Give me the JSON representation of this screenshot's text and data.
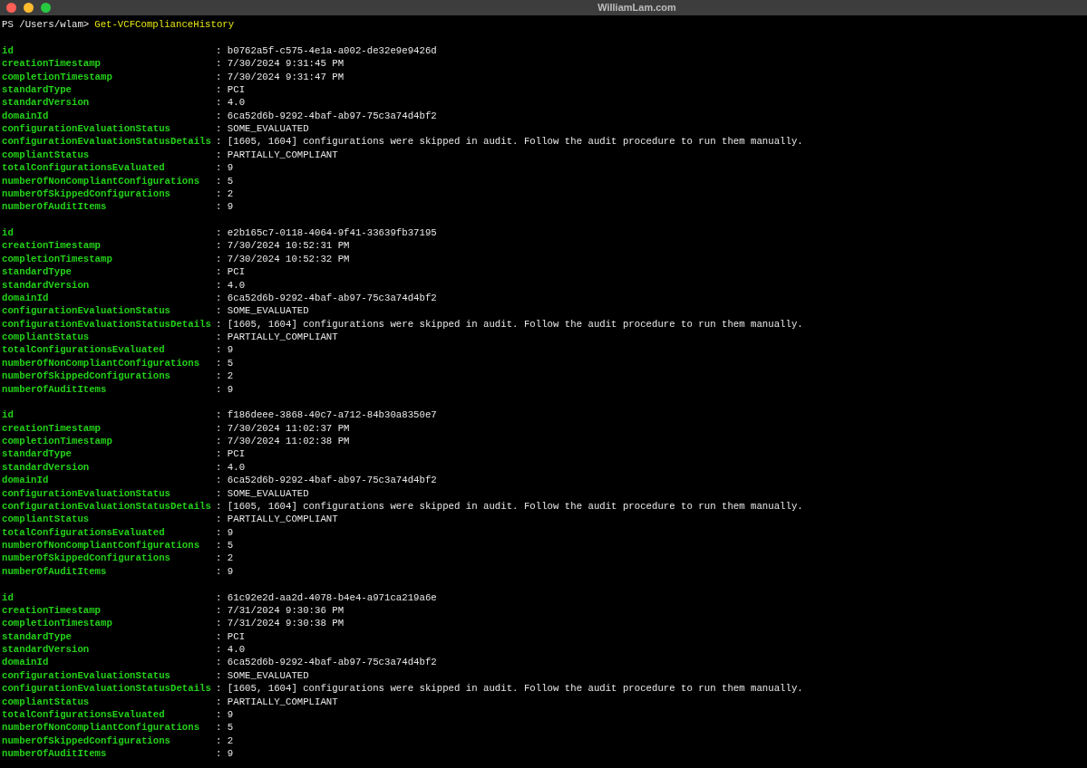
{
  "window": {
    "title": "WilliamLam.com"
  },
  "prompt": {
    "path": "PS /Users/wlam>",
    "command": "Get-VCFComplianceHistory"
  },
  "records": [
    {
      "fields": [
        {
          "key": "id",
          "value": ": b0762a5f-c575-4e1a-a002-de32e9e9426d"
        },
        {
          "key": "creationTimestamp",
          "value": ": 7/30/2024 9:31:45 PM"
        },
        {
          "key": "completionTimestamp",
          "value": ": 7/30/2024 9:31:47 PM"
        },
        {
          "key": "standardType",
          "value": ": PCI"
        },
        {
          "key": "standardVersion",
          "value": ": 4.0"
        },
        {
          "key": "domainId",
          "value": ": 6ca52d6b-9292-4baf-ab97-75c3a74d4bf2"
        },
        {
          "key": "configurationEvaluationStatus",
          "value": ": SOME_EVALUATED"
        },
        {
          "key": "configurationEvaluationStatusDetails",
          "value": ": [1605, 1604] configurations were skipped in audit. Follow the audit procedure to run them manually."
        },
        {
          "key": "compliantStatus",
          "value": ": PARTIALLY_COMPLIANT"
        },
        {
          "key": "totalConfigurationsEvaluated",
          "value": ": 9"
        },
        {
          "key": "numberOfNonCompliantConfigurations",
          "value": ": 5"
        },
        {
          "key": "numberOfSkippedConfigurations",
          "value": ": 2"
        },
        {
          "key": "numberOfAuditItems",
          "value": ": 9"
        }
      ]
    },
    {
      "fields": [
        {
          "key": "id",
          "value": ": e2b165c7-0118-4064-9f41-33639fb37195"
        },
        {
          "key": "creationTimestamp",
          "value": ": 7/30/2024 10:52:31 PM"
        },
        {
          "key": "completionTimestamp",
          "value": ": 7/30/2024 10:52:32 PM"
        },
        {
          "key": "standardType",
          "value": ": PCI"
        },
        {
          "key": "standardVersion",
          "value": ": 4.0"
        },
        {
          "key": "domainId",
          "value": ": 6ca52d6b-9292-4baf-ab97-75c3a74d4bf2"
        },
        {
          "key": "configurationEvaluationStatus",
          "value": ": SOME_EVALUATED"
        },
        {
          "key": "configurationEvaluationStatusDetails",
          "value": ": [1605, 1604] configurations were skipped in audit. Follow the audit procedure to run them manually."
        },
        {
          "key": "compliantStatus",
          "value": ": PARTIALLY_COMPLIANT"
        },
        {
          "key": "totalConfigurationsEvaluated",
          "value": ": 9"
        },
        {
          "key": "numberOfNonCompliantConfigurations",
          "value": ": 5"
        },
        {
          "key": "numberOfSkippedConfigurations",
          "value": ": 2"
        },
        {
          "key": "numberOfAuditItems",
          "value": ": 9"
        }
      ]
    },
    {
      "fields": [
        {
          "key": "id",
          "value": ": f186deee-3868-40c7-a712-84b30a8350e7"
        },
        {
          "key": "creationTimestamp",
          "value": ": 7/30/2024 11:02:37 PM"
        },
        {
          "key": "completionTimestamp",
          "value": ": 7/30/2024 11:02:38 PM"
        },
        {
          "key": "standardType",
          "value": ": PCI"
        },
        {
          "key": "standardVersion",
          "value": ": 4.0"
        },
        {
          "key": "domainId",
          "value": ": 6ca52d6b-9292-4baf-ab97-75c3a74d4bf2"
        },
        {
          "key": "configurationEvaluationStatus",
          "value": ": SOME_EVALUATED"
        },
        {
          "key": "configurationEvaluationStatusDetails",
          "value": ": [1605, 1604] configurations were skipped in audit. Follow the audit procedure to run them manually."
        },
        {
          "key": "compliantStatus",
          "value": ": PARTIALLY_COMPLIANT"
        },
        {
          "key": "totalConfigurationsEvaluated",
          "value": ": 9"
        },
        {
          "key": "numberOfNonCompliantConfigurations",
          "value": ": 5"
        },
        {
          "key": "numberOfSkippedConfigurations",
          "value": ": 2"
        },
        {
          "key": "numberOfAuditItems",
          "value": ": 9"
        }
      ]
    },
    {
      "fields": [
        {
          "key": "id",
          "value": ": 61c92e2d-aa2d-4078-b4e4-a971ca219a6e"
        },
        {
          "key": "creationTimestamp",
          "value": ": 7/31/2024 9:30:36 PM"
        },
        {
          "key": "completionTimestamp",
          "value": ": 7/31/2024 9:30:38 PM"
        },
        {
          "key": "standardType",
          "value": ": PCI"
        },
        {
          "key": "standardVersion",
          "value": ": 4.0"
        },
        {
          "key": "domainId",
          "value": ": 6ca52d6b-9292-4baf-ab97-75c3a74d4bf2"
        },
        {
          "key": "configurationEvaluationStatus",
          "value": ": SOME_EVALUATED"
        },
        {
          "key": "configurationEvaluationStatusDetails",
          "value": ": [1605, 1604] configurations were skipped in audit. Follow the audit procedure to run them manually."
        },
        {
          "key": "compliantStatus",
          "value": ": PARTIALLY_COMPLIANT"
        },
        {
          "key": "totalConfigurationsEvaluated",
          "value": ": 9"
        },
        {
          "key": "numberOfNonCompliantConfigurations",
          "value": ": 5"
        },
        {
          "key": "numberOfSkippedConfigurations",
          "value": ": 2"
        },
        {
          "key": "numberOfAuditItems",
          "value": ": 9"
        }
      ]
    }
  ]
}
